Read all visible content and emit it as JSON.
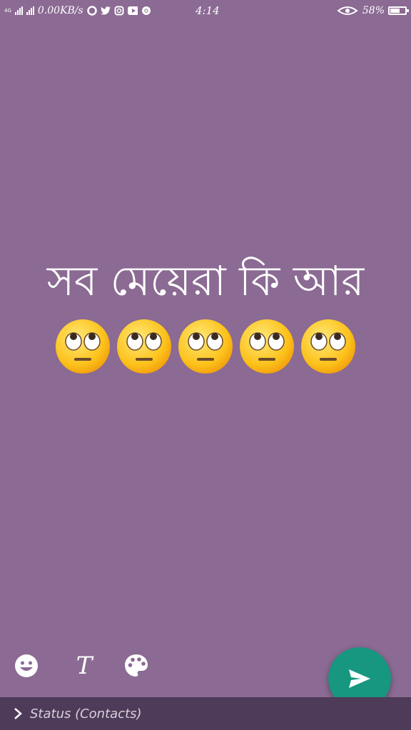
{
  "status_bar": {
    "network": "4G",
    "data_rate": "0.00KB/s",
    "time": "4:14",
    "battery_percent": "58%",
    "battery_level": 0.58,
    "notification_icons": [
      "circle-app-icon",
      "twitter-icon",
      "instagram-icon",
      "youtube-icon",
      "chrome-icon"
    ]
  },
  "composer": {
    "text": "সব মেয়েরা কি আর",
    "emoji": "face-with-rolling-eyes",
    "emoji_count": 5
  },
  "toolbar": {
    "emoji_icon": "emoji-icon",
    "text_label": "T",
    "palette_icon": "palette-icon"
  },
  "send_button": {
    "icon": "send-icon"
  },
  "audience": {
    "label": "Status (Contacts)"
  },
  "colors": {
    "background": "#8b6a93",
    "fab": "#17977f",
    "bottom_bar": "#4e3a59"
  }
}
